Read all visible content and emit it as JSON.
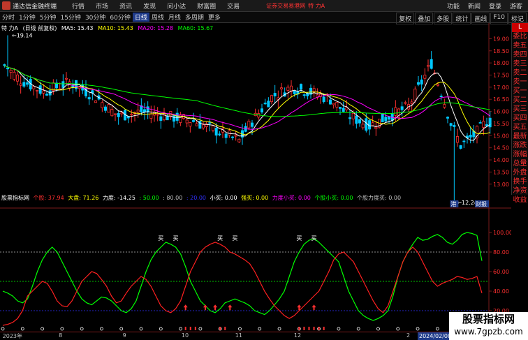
{
  "titlebar": {
    "app_title": "通达信金融终端",
    "menu": [
      "行情",
      "市场",
      "资讯",
      "发现",
      "问小达",
      "财富圈",
      "交易"
    ],
    "promo": "证券交易易港网",
    "promo_ticker": "特 力A",
    "right_menu": [
      "功能",
      "新闻",
      "登录",
      "游客"
    ]
  },
  "toolbar": {
    "periods": [
      "分时",
      "1分钟",
      "5分钟",
      "15分钟",
      "30分钟",
      "60分钟",
      "日线",
      "周线",
      "月线",
      "多周期",
      "更多"
    ],
    "active_period": "日线",
    "tools": [
      "复权",
      "叠加",
      "多股",
      "统计",
      "画线",
      "F10",
      "标记"
    ]
  },
  "main_chart": {
    "ticker": "特 力A",
    "adjust": "(日线 前复权)",
    "ma": [
      {
        "label": "MA5: 15.43",
        "color": "#ffffff"
      },
      {
        "label": "MA10: 15.43",
        "color": "#ffff00"
      },
      {
        "label": "MA20: 15.28",
        "color": "#ff00ff"
      },
      {
        "label": "MA60: 15.67",
        "color": "#00ff00"
      }
    ],
    "high_label": "19.14",
    "low_label": "12.24",
    "price_ticks": [
      "19.00",
      "18.50",
      "18.00",
      "17.50",
      "17.00",
      "16.50",
      "16.00",
      "15.50",
      "15.00",
      "14.50",
      "14.00",
      "13.50",
      "13.00"
    ],
    "event_tags": [
      "港",
      "财报"
    ]
  },
  "sidebar": {
    "items": [
      "L",
      "委比",
      "卖五",
      "卖四",
      "卖三",
      "卖二",
      "卖一",
      "买一",
      "买二",
      "买三",
      "买四",
      "买五",
      "最新",
      "涨跌",
      "涨幅",
      "总量",
      "外盘",
      "换手",
      "净资",
      "收益"
    ]
  },
  "indicator": {
    "name": "股票指标网",
    "fields": [
      {
        "text": "个股: 37.94",
        "color": "#ff3030"
      },
      {
        "text": "大盘: 71.26",
        "color": "#ffff00"
      },
      {
        "text": "力度: -14.25",
        "color": "#ffffff"
      },
      {
        "text": ": 50.00",
        "color": "#00ff00"
      },
      {
        "text": ": 80.00",
        "color": "#c0c0c0"
      },
      {
        "text": ": 20.00",
        "color": "#3030ff"
      },
      {
        "text": "小买: 0.00",
        "color": "#ffffff"
      },
      {
        "text": "强买: 0.00",
        "color": "#ffff00"
      },
      {
        "text": "力度小买: 0.00",
        "color": "#ff00ff"
      },
      {
        "text": "个股小买: 0.00",
        "color": "#00ff00"
      },
      {
        "text": "个股力度买: 0.00",
        "color": "#c0c0c0"
      }
    ],
    "right_ticks": [
      "100.00",
      "80.00",
      "60.00",
      "40.00",
      "20.00",
      "0.00"
    ],
    "buy_label": "买",
    "line_data": {
      "stock": [
        5,
        6,
        8,
        12,
        20,
        35,
        40,
        45,
        50,
        48,
        40,
        30,
        25,
        24,
        30,
        40,
        50,
        55,
        60,
        58,
        52,
        45,
        35,
        28,
        30,
        38,
        45,
        50,
        55,
        52,
        45,
        35,
        25,
        20,
        18,
        22,
        30,
        45,
        60,
        70,
        80,
        85,
        88,
        90,
        88,
        85,
        80,
        78,
        75,
        72,
        68,
        60,
        50,
        40,
        32,
        25,
        20,
        15,
        12,
        15,
        20,
        25,
        30,
        35,
        40,
        50,
        60,
        72,
        78,
        80,
        75,
        70,
        60,
        50,
        40,
        30,
        22,
        18,
        25,
        40,
        55,
        70,
        80,
        85,
        80,
        70,
        60,
        50,
        45,
        48,
        50,
        52,
        55,
        54,
        52,
        53,
        55,
        38
      ],
      "market": [
        40,
        38,
        35,
        30,
        28,
        32,
        45,
        60,
        72,
        80,
        85,
        80,
        70,
        60,
        50,
        40,
        32,
        28,
        26,
        30,
        34,
        33,
        30,
        25,
        20,
        18,
        22,
        30,
        45,
        60,
        72,
        80,
        85,
        90,
        88,
        85,
        78,
        65,
        50,
        40,
        30,
        25,
        20,
        18,
        22,
        28,
        30,
        32,
        30,
        28,
        25,
        20,
        18,
        16,
        20,
        26,
        32,
        40,
        55,
        70,
        80,
        88,
        92,
        94,
        90,
        85,
        80,
        75,
        70,
        55,
        40,
        30,
        20,
        15,
        12,
        10,
        12,
        15,
        20,
        35,
        55,
        70,
        80,
        88,
        95,
        92,
        93,
        96,
        98,
        95,
        90,
        88,
        92,
        98,
        100,
        99,
        97,
        71
      ]
    },
    "buy_positions": [
      32,
      35,
      44,
      47,
      60,
      63
    ],
    "arrow_positions": [
      37,
      41,
      43,
      46,
      60,
      63
    ],
    "dot_positions": [
      0,
      4,
      8,
      12,
      16,
      20,
      24,
      28,
      32,
      36,
      40,
      44,
      48,
      52,
      56,
      60,
      64,
      68,
      72,
      76,
      80,
      84,
      88,
      92,
      96
    ]
  },
  "dates": {
    "labels": [
      {
        "text": "2023年",
        "pos": 0.005
      },
      {
        "text": "8",
        "pos": 0.115
      },
      {
        "text": "9",
        "pos": 0.24
      },
      {
        "text": "10",
        "pos": 0.355
      },
      {
        "text": "11",
        "pos": 0.46
      },
      {
        "text": "12",
        "pos": 0.575
      },
      {
        "text": "2",
        "pos": 0.795
      }
    ],
    "current": "2024/02/08/四"
  },
  "watermark": {
    "line1": "股票指标网",
    "line2": "www.7gpzb.com"
  },
  "colors": {
    "up": "#ff3030",
    "down": "#00c8ff",
    "ma5": "#ffffff",
    "ma10": "#ffff00",
    "ma20": "#ff00ff",
    "ma60": "#00ff00"
  }
}
